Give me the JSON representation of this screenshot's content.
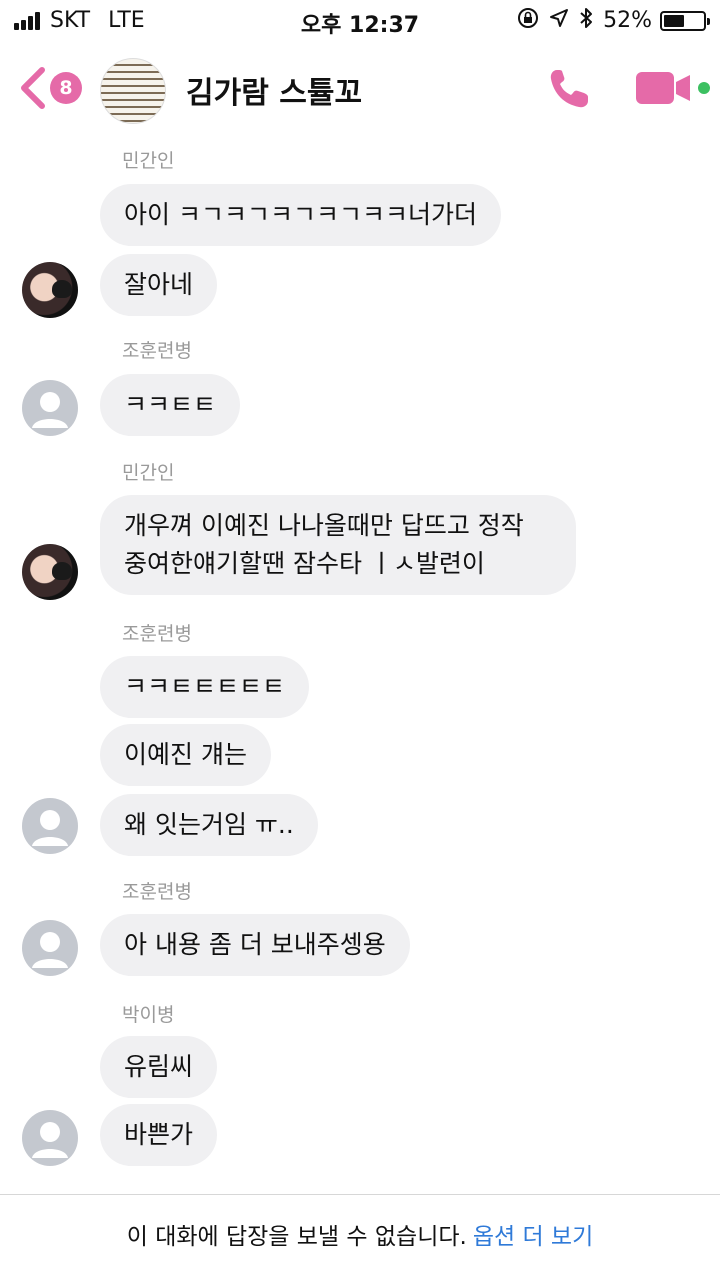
{
  "status_bar": {
    "carrier": "SKT",
    "network": "LTE",
    "time": "오후 12:37",
    "battery_percent": "52%",
    "battery_level": 0.52,
    "icons": [
      "orientation-lock-icon",
      "location-icon",
      "bluetooth-icon",
      "battery-icon"
    ]
  },
  "header": {
    "back_badge": "8",
    "title": "김가람 스튤꼬",
    "accent_color": "#e56aa8",
    "online_color": "#3cc061"
  },
  "messages": [
    {
      "type": "sender",
      "text": "민간인"
    },
    {
      "type": "bubble",
      "text": "아이 ㅋㄱㅋㄱㅋㄱㅋㄱㅋㅋ너가더"
    },
    {
      "type": "bubble",
      "text": "잘아네"
    },
    {
      "type": "sender",
      "text": "조훈련병"
    },
    {
      "type": "bubble",
      "text": "ㅋㅋㅌㅌ"
    },
    {
      "type": "sender",
      "text": "민간인"
    },
    {
      "type": "bubble",
      "text": "개우껴 이예진 나나올때만 답뜨고 정작 중여한얘기할땐 잠수타 ㅣㅅ발련이"
    },
    {
      "type": "sender",
      "text": "조훈련병"
    },
    {
      "type": "bubble",
      "text": "ㅋㅋㅌㅌㅌㅌㅌ"
    },
    {
      "type": "bubble",
      "text": "이예진 걔는"
    },
    {
      "type": "bubble",
      "text": "왜 잇는거임 ㅠ.."
    },
    {
      "type": "sender",
      "text": "조훈련병"
    },
    {
      "type": "bubble",
      "text": "아 내용 좀 더 보내주셍용"
    },
    {
      "type": "sender",
      "text": "박이병"
    },
    {
      "type": "bubble",
      "text": "유림씨"
    },
    {
      "type": "bubble",
      "text": "바쁜가"
    }
  ],
  "footer": {
    "notice": "이 대화에 답장을 보낼 수 없습니다.",
    "link": "옵션 더 보기"
  }
}
